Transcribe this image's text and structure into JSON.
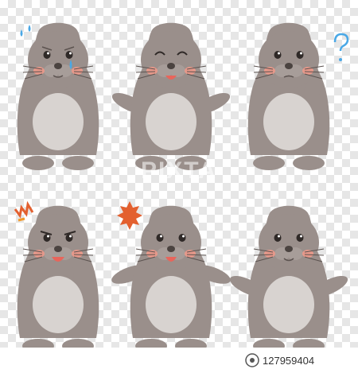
{
  "watermark_text": "PIXTA",
  "footer": {
    "image_code": "127959404"
  },
  "colors": {
    "body": "#9a8f8b",
    "belly": "#d8d3d0",
    "outline": "#5c5350",
    "cheek": "#f29a8a",
    "mouth": "#e8655b",
    "sweat": "#4aa8e6",
    "anger": "#e3602f",
    "accent": "#f29b2b"
  },
  "characters": [
    {
      "label": "crying"
    },
    {
      "label": "happy"
    },
    {
      "label": "confused"
    },
    {
      "label": "angry"
    },
    {
      "label": "surprised"
    },
    {
      "label": "neutral"
    }
  ]
}
